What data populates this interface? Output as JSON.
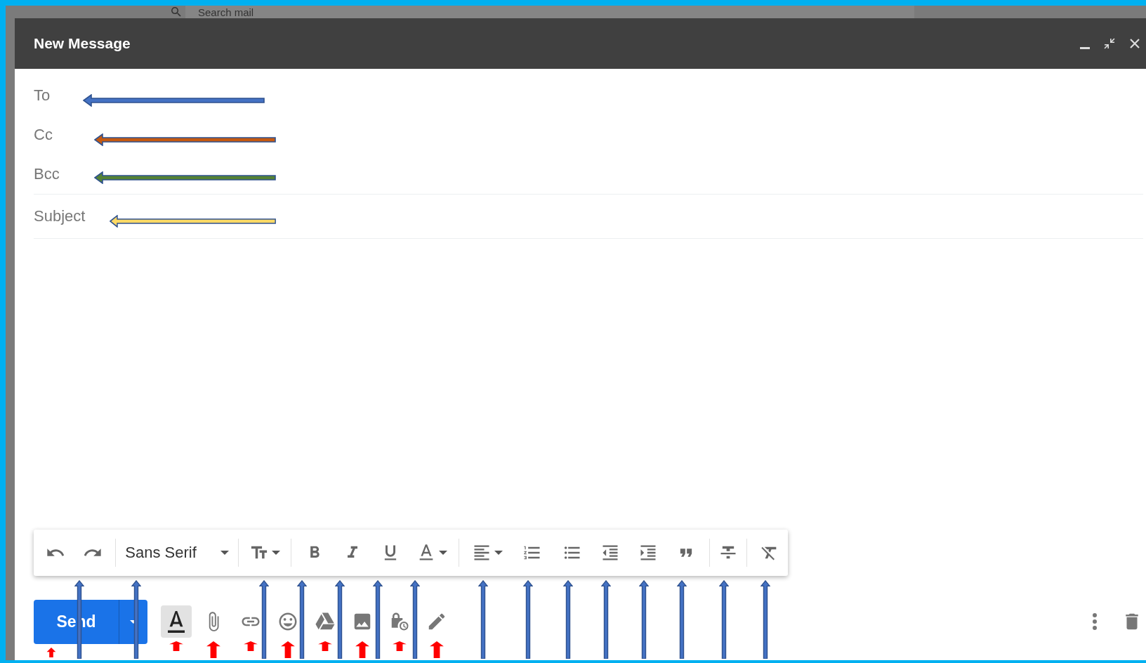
{
  "background": {
    "search_placeholder": "Search mail"
  },
  "compose": {
    "title": "New Message",
    "header_buttons": [
      {
        "kind": "minimize"
      },
      {
        "kind": "expand"
      },
      {
        "kind": "close"
      }
    ],
    "fields": [
      {
        "label": "To",
        "arrow": {
          "color": "#4472c4"
        }
      },
      {
        "label": "Cc",
        "arrow": {
          "color": "#c55a11"
        }
      },
      {
        "label": "Bcc",
        "arrow": {
          "color": "#548235"
        }
      },
      {
        "label": "Subject",
        "arrow": {
          "color": "#ffd966"
        }
      }
    ],
    "format_toolbar": {
      "groups": [
        [
          {
            "kind": "undo",
            "arrow": false
          },
          {
            "kind": "redo",
            "arrow": true
          }
        ],
        [
          {
            "kind": "font",
            "label": "Sans Serif",
            "arrow": true
          }
        ],
        [
          {
            "kind": "size",
            "arrow": true
          }
        ],
        [
          {
            "kind": "bold",
            "arrow": true
          },
          {
            "kind": "italic",
            "arrow": true
          },
          {
            "kind": "underline",
            "arrow": true
          },
          {
            "kind": "text_color",
            "arrow": true
          }
        ],
        [
          {
            "kind": "align",
            "arrow": true
          },
          {
            "kind": "numbered_list",
            "arrow": true
          },
          {
            "kind": "bulleted_list",
            "arrow": true
          },
          {
            "kind": "indent_less",
            "arrow": true
          },
          {
            "kind": "indent_more",
            "arrow": true
          },
          {
            "kind": "quote",
            "arrow": true
          }
        ],
        [
          {
            "kind": "strikethrough",
            "arrow": true
          }
        ],
        [
          {
            "kind": "clear_formatting",
            "arrow": true
          }
        ]
      ]
    },
    "bottom_bar": {
      "send": {
        "label": "Send",
        "arrow": true
      },
      "tools": [
        {
          "kind": "formatting",
          "selected": true,
          "arrow": true
        },
        {
          "kind": "attach",
          "selected": false,
          "arrow": true
        },
        {
          "kind": "link",
          "selected": false,
          "arrow": true
        },
        {
          "kind": "emoji",
          "selected": false,
          "arrow": true
        },
        {
          "kind": "drive",
          "selected": false,
          "arrow": true
        },
        {
          "kind": "photo",
          "selected": false,
          "arrow": true
        },
        {
          "kind": "confidential",
          "selected": false,
          "arrow": true
        },
        {
          "kind": "signature",
          "selected": false,
          "arrow": true
        }
      ],
      "end_tools": [
        {
          "kind": "more"
        },
        {
          "kind": "discard"
        }
      ]
    }
  }
}
